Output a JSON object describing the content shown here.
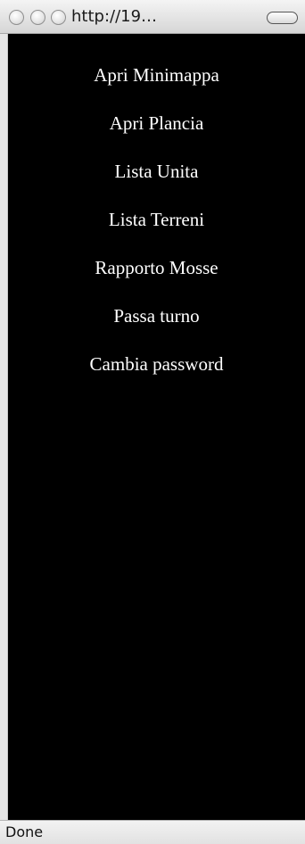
{
  "browser": {
    "url_display": "http://19…",
    "status": "Done",
    "buttons": [
      "close-icon",
      "minimize-icon",
      "zoom-icon"
    ],
    "toolbar_toggle_icon": "toolbar-toggle-icon"
  },
  "menu": {
    "items": [
      "Apri Minimappa",
      "Apri Plancia",
      "Lista Unita",
      "Lista Terreni",
      "Rapporto Mosse",
      "Passa turno",
      "Cambia password"
    ]
  },
  "colors": {
    "background": "#000000",
    "text": "#ffffff"
  }
}
